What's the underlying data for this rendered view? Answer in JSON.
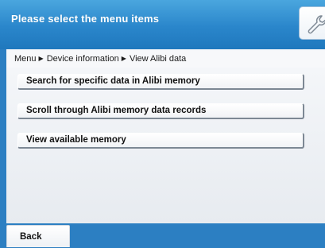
{
  "header": {
    "title": "Please select the menu items",
    "icon": "wrench-icon"
  },
  "breadcrumb": {
    "items": [
      "Menu",
      "Device information",
      "View Alibi data"
    ],
    "separator_icon": "triangle-right-icon"
  },
  "menu": {
    "items": [
      {
        "label": "Search for specific data in Alibi memory"
      },
      {
        "label": "Scroll through Alibi memory data records"
      },
      {
        "label": "View available memory"
      }
    ]
  },
  "footer": {
    "back_label": "Back"
  },
  "colors": {
    "header_blue": "#2c7fc2",
    "content_bg": "#eef1f5",
    "button_bg": "#ffffff",
    "text": "#121212"
  }
}
